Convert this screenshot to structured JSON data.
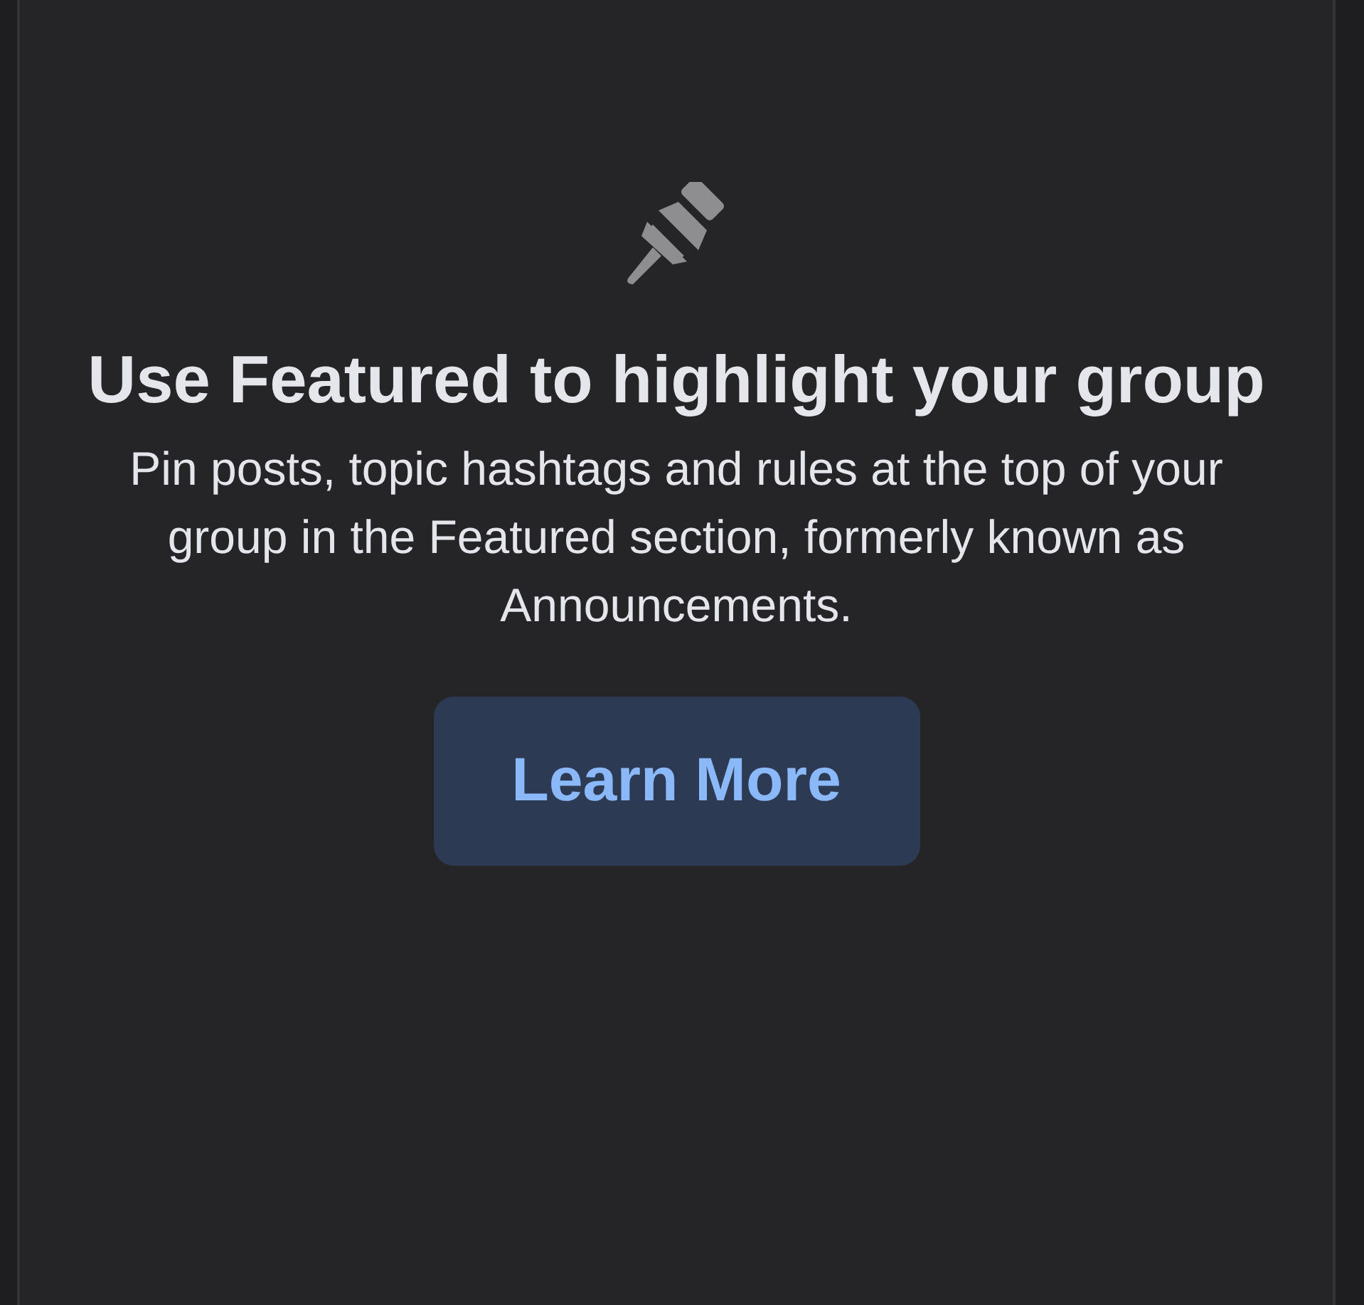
{
  "empty_state": {
    "title": "Use Featured to highlight your group",
    "description": "Pin posts, topic hashtags and rules at the top of your group in the Featured section, formerly known as Announcements.",
    "button": "Learn More"
  }
}
